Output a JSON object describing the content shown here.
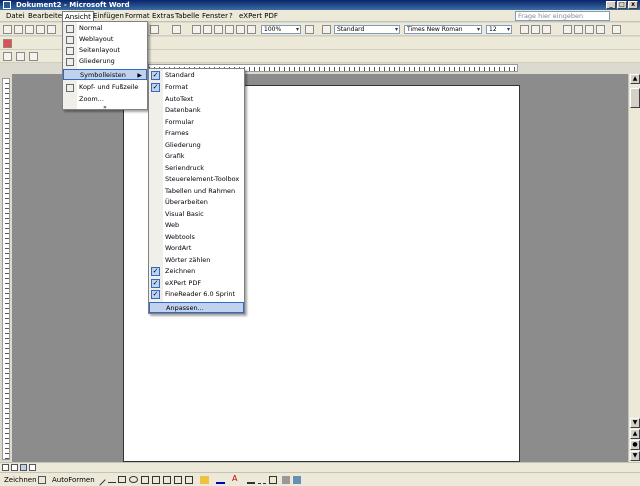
{
  "window": {
    "title": "Dokument2 - Microsoft Word",
    "controls": [
      "_",
      "□",
      "x"
    ]
  },
  "menubar": {
    "items": [
      "Datei",
      "Bearbeiten",
      "Ansicht",
      "Einfügen",
      "Format",
      "Extras",
      "Tabelle",
      "Fenster",
      "?",
      "eXPert PDF"
    ],
    "help_placeholder": "Frage hier eingeben"
  },
  "formatting": {
    "zoom": "100%",
    "style": "Standard",
    "font": "Times New Roman",
    "size": "12"
  },
  "ansicht_menu": {
    "items": [
      "Normal",
      "Weblayout",
      "Seitenlayout",
      "Gliederung",
      "Symbolleisten",
      "Kopf- und Fußzeile",
      "Zoom..."
    ]
  },
  "symbolleisten_menu": {
    "items": [
      {
        "label": "Standard",
        "checked": true
      },
      {
        "label": "Format",
        "checked": true
      },
      {
        "label": "AutoText",
        "checked": false
      },
      {
        "label": "Datenbank",
        "checked": false
      },
      {
        "label": "Formular",
        "checked": false
      },
      {
        "label": "Frames",
        "checked": false
      },
      {
        "label": "Gliederung",
        "checked": false
      },
      {
        "label": "Grafik",
        "checked": false
      },
      {
        "label": "Seriendruck",
        "checked": false
      },
      {
        "label": "Steuerelement-Toolbox",
        "checked": false
      },
      {
        "label": "Tabellen und Rahmen",
        "checked": false
      },
      {
        "label": "Überarbeiten",
        "checked": false
      },
      {
        "label": "Visual Basic",
        "checked": false
      },
      {
        "label": "Web",
        "checked": false
      },
      {
        "label": "Webtools",
        "checked": false
      },
      {
        "label": "WordArt",
        "checked": false
      },
      {
        "label": "Wörter zählen",
        "checked": false
      },
      {
        "label": "Zeichnen",
        "checked": true
      },
      {
        "label": "eXPert PDF",
        "checked": true
      },
      {
        "label": "FineReader 6.0 Sprint",
        "checked": true
      },
      {
        "label": "Anpassen...",
        "checked": false
      }
    ]
  },
  "drawing_toolbar": {
    "zeichnen": "Zeichnen",
    "autoformen": "AutoFormen"
  }
}
